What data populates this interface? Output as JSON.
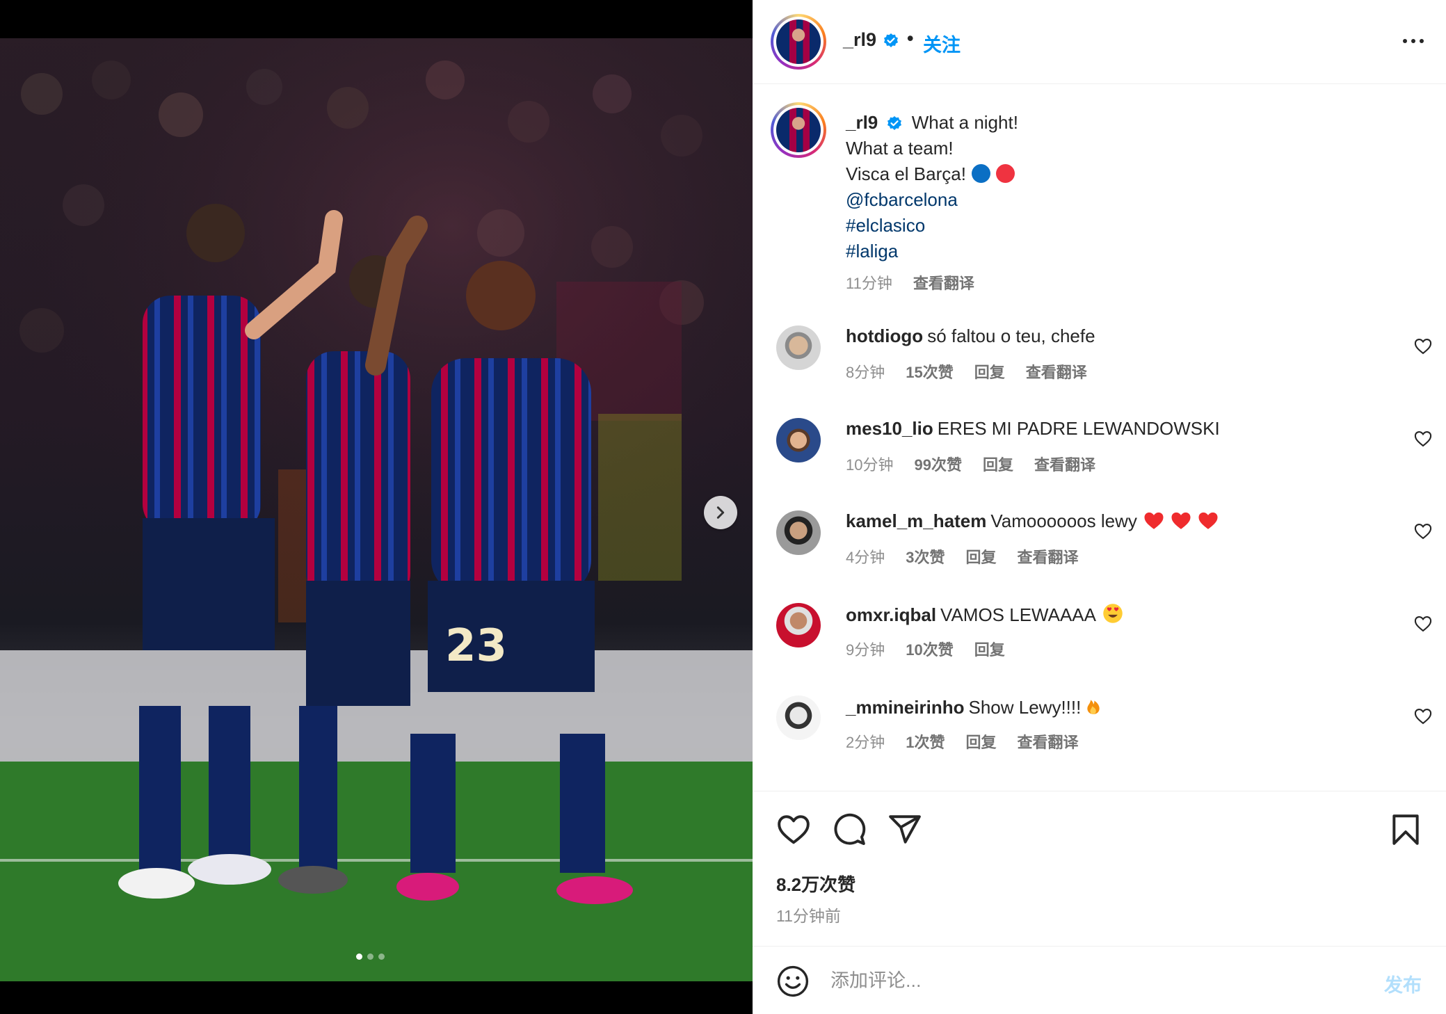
{
  "post": {
    "username": "_rl9",
    "follow_label": "关注",
    "separator": "•"
  },
  "caption": {
    "username": "_rl9",
    "line1": "What a night!",
    "line2": "What a team!",
    "line3": "Visca el Barça!",
    "mention": "@fcbarcelona",
    "tag1": "#elclasico",
    "tag2": "#laliga",
    "time": "11分钟",
    "translate": "查看翻译",
    "emoji_colors": [
      "#0b6fc4",
      "#ef3340"
    ]
  },
  "comments": [
    {
      "username": "hotdiogo",
      "text": "só faltou o teu, chefe",
      "emoji": "",
      "time": "8分钟",
      "likes": "15次赞",
      "reply": "回复",
      "translate": "查看翻译"
    },
    {
      "username": "mes10_lio",
      "text": "ERES MI PADRE LEWANDOWSKI",
      "emoji": "",
      "time": "10分钟",
      "likes": "99次赞",
      "reply": "回复",
      "translate": "查看翻译"
    },
    {
      "username": "kamel_m_hatem",
      "text": "Vamoooooos lewy",
      "emoji": "red-heart x3",
      "time": "4分钟",
      "likes": "3次赞",
      "reply": "回复",
      "translate": "查看翻译"
    },
    {
      "username": "omxr.iqbal",
      "text": "VAMOS LEWAAAA",
      "emoji": "heart-eyes",
      "time": "9分钟",
      "likes": "10次赞",
      "reply": "回复",
      "translate": ""
    },
    {
      "username": "_mmineirinho",
      "text": "Show Lewy!!!!",
      "emoji": "fire",
      "time": "2分钟",
      "likes": "1次赞",
      "reply": "回复",
      "translate": "查看翻译"
    }
  ],
  "stats": {
    "likes": "8.2万次赞",
    "posted": "11分钟前"
  },
  "composer": {
    "placeholder": "添加评论...",
    "post_label": "发布"
  },
  "media": {
    "jersey_number": "23",
    "active_slide": 1,
    "total_slides": 3
  },
  "colors": {
    "accent_blue": "#0095f6",
    "link_blue": "#00376b",
    "muted": "#8e8e8e",
    "post_disabled": "#b2dffc",
    "barca_blue": "#0a2a6b",
    "barca_red": "#a50044"
  }
}
